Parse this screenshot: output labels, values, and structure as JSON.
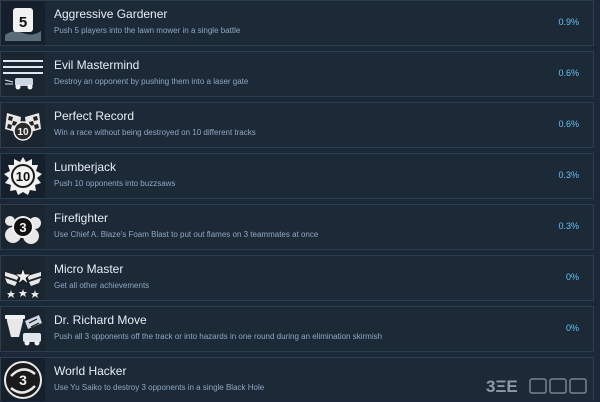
{
  "achievements": [
    {
      "icon": "number-5-icon",
      "title": "Aggressive Gardener",
      "description": "Push 5 players into the lawn mower in a single battle",
      "percent": "0.9%"
    },
    {
      "icon": "laser-gate-icon",
      "title": "Evil Mastermind",
      "description": "Destroy an opponent by pushing them into a laser gate",
      "percent": "0.6%"
    },
    {
      "icon": "checkered-flags-10-icon",
      "title": "Perfect Record",
      "description": "Win a race without being destroyed on 10 different tracks",
      "percent": "0.6%"
    },
    {
      "icon": "buzzsaw-10-icon",
      "title": "Lumberjack",
      "description": "Push 10 opponents into buzzsaws",
      "percent": "0.3%"
    },
    {
      "icon": "foam-3-icon",
      "title": "Firefighter",
      "description": "Use Chief A. Blaze's Foam Blast to put out flames on 3 teammates at once",
      "percent": "0.3%"
    },
    {
      "icon": "winged-stars-icon",
      "title": "Micro Master",
      "description": "Get all other achievements",
      "percent": "0%"
    },
    {
      "icon": "car-hazard-icon",
      "title": "Dr. Richard Move",
      "description": "Push all 3 opponents off the track or into hazards in one round during an elimination skirmish",
      "percent": "0%"
    },
    {
      "icon": "black-hole-3-icon",
      "title": "World Hacker",
      "description": "Use Yu Saiko to destroy 3 opponents in a single Black Hole",
      "percent": ""
    }
  ],
  "watermark": {
    "icon": "3dm-watermark-logo-icon"
  },
  "colors": {
    "background": "#1b2838",
    "row": "#1c2a38",
    "title": "#e8eef5",
    "description": "#8fa7bf",
    "percent": "#67c1f5"
  }
}
